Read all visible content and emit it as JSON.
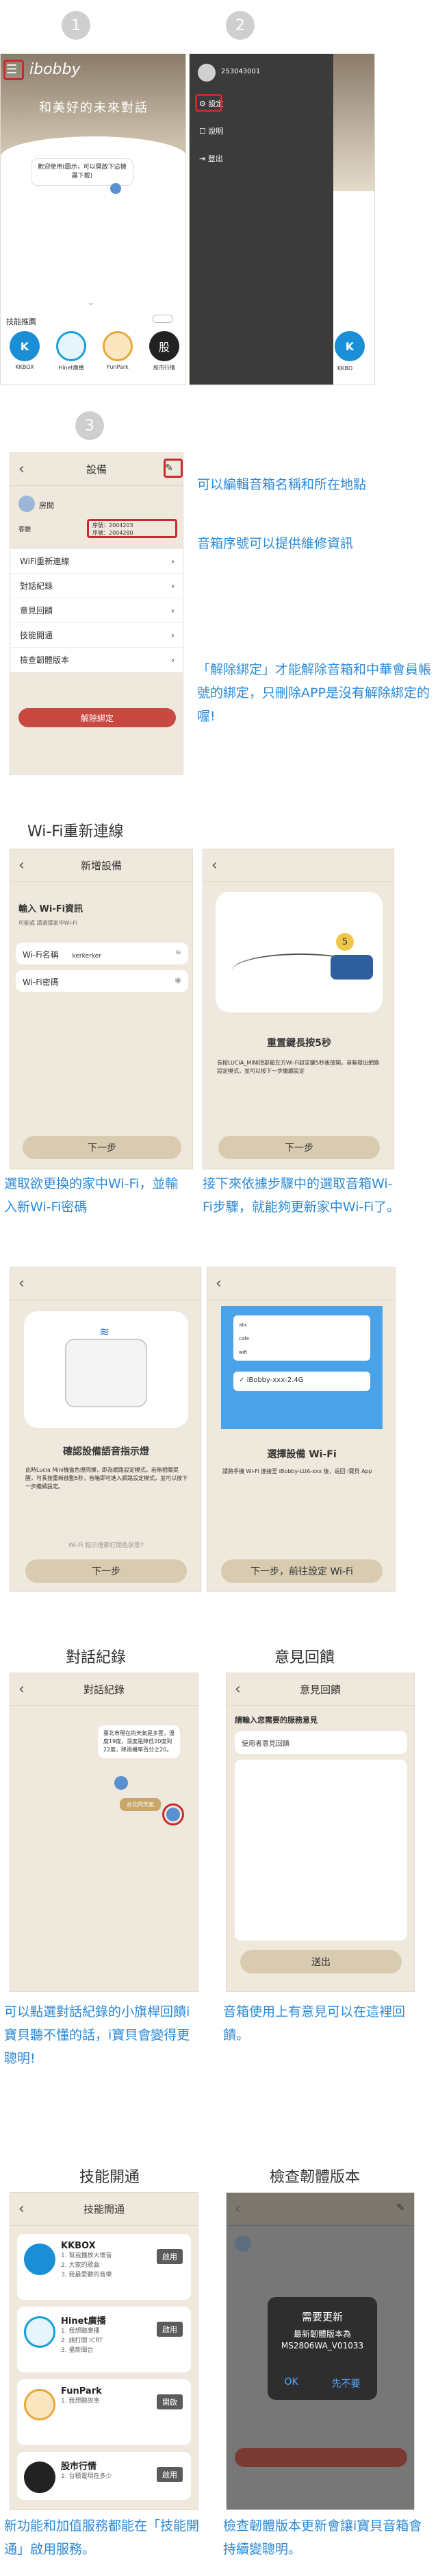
{
  "step_numbers": [
    "1",
    "2",
    "3"
  ],
  "home": {
    "logo": "ibobby",
    "slogan": "和美好的未來對話",
    "bubble": "歡迎使用(圖示，可以開啟下這機器下載)",
    "skills_title": "技能推薦",
    "skills": [
      {
        "label": "KKBOX",
        "color": "#1b8fd6",
        "icon": "kkbox-icon"
      },
      {
        "label": "Hinet廣播",
        "color": "#1aa0d8",
        "icon": "hinet-icon"
      },
      {
        "label": "FunPark",
        "color": "#e8a83a",
        "icon": "funpark-icon"
      },
      {
        "label": "股市行情",
        "color": "#222222",
        "icon": "stock-icon"
      }
    ]
  },
  "menu": {
    "phone": "253043001",
    "items": [
      "設定",
      "說明",
      "登出"
    ],
    "side_label": "KKBO"
  },
  "settings": {
    "title": "設備",
    "device_name": "房間",
    "serial_label": "序號：2004203",
    "serial_2": "序號：2004280",
    "location": "客廳",
    "menu": [
      "WiFi重新連線",
      "對話紀錄",
      "意見回饋",
      "技能開通",
      "檢查韌體版本"
    ],
    "unbind": "解除綁定",
    "note1": "可以編輯音箱名稱和所在地點",
    "note2": "音箱序號可以提供維修資訊",
    "note3": "「解除綁定」才能解除音箱和中華會員帳號的綁定，只刪除APP是沒有解除綁定的喔!"
  },
  "wifi": {
    "section": "Wi-Fi重新連線",
    "s1_title": "新增設備",
    "s1_head": "輸入 Wi-Fi資訊",
    "s1_sub": "可能或 請選擇家中Wi-Fi",
    "s1_name_label": "Wi-Fi名稱",
    "s1_name_val": "kerkerker",
    "s1_pw_label": "Wi-Fi密碼",
    "next": "下一步",
    "s2_title": "重置鍵長按5秒",
    "s2_timer": "5",
    "s2_desc": "長按LUCIA_MINI頂部最左方Wi-Fi設定鍵5秒後放開，音箱發出網路設定模式，並可以按下一步繼續設定",
    "s3_title": "確認設備語音指示燈",
    "s3_desc": "此時Lucia Mini機盒色燈閃爍，即為網路設定模式，若無相關提醒，可長按重新啟動5秒，音箱即可進入網路設定模式，並可以按下一步繼續設定。",
    "s3_link": "Wi-Fi 指示燈都打開色狀態?",
    "s4_title": "選擇設備 Wi-Fi",
    "s4_desc": "請將手機 Wi-Fi 連接至 iBobby-LUA-xxx 後，返回 i寶貝 App",
    "s4_wifi": [
      "abc",
      "cafe",
      "wifi"
    ],
    "s4_sel": "iBobby-xxx-2.4G",
    "s4_next": "下一步，前往設定 Wi-Fi",
    "cap1": "選取欲更換的家中Wi-Fi，並輸入新Wi-Fi密碼",
    "cap2": "接下來依據步驟中的選取音箱Wi-Fi步驟，就能夠更新家中Wi-Fi了。"
  },
  "dialog": {
    "section": "對話紀錄",
    "title": "對話紀錄",
    "msg1": "臺北市現在的天氣是多雲，溫度19度，濕度是降低20度到22度，降雨機率百分之20。",
    "msg2": "台北的天氣",
    "cap": "可以點選對話紀錄的小旗桿回饋i寶貝聽不懂的話，i寶貝會變得更聰明!"
  },
  "feedback": {
    "section": "意見回饋",
    "title": "意見回饋",
    "prompt": "請輸入您需要的服務意見",
    "placeholder": "使用者意見回饋",
    "send": "送出",
    "cap": "音箱使用上有意見可以在這裡回饋。"
  },
  "skillopen": {
    "section": "技能開通",
    "title": "技能開通",
    "items": [
      {
        "name": "KKBOX",
        "lines": [
          "1. 幫我播放大壞音",
          "2. 大家的歌曲",
          "3. 我最愛聽的音樂"
        ],
        "status": "啟用"
      },
      {
        "name": "Hinet廣播",
        "lines": [
          "1. 我想聽廣播",
          "2. 請打開 ICRT",
          "3. 播新聞台"
        ],
        "status": "啟用"
      },
      {
        "name": "FunPark",
        "lines": [
          "1. 我想聽故事"
        ],
        "status": "開啟"
      },
      {
        "name": "股市行情",
        "lines": [
          "1. 台積電現在多少"
        ],
        "status": "啟用"
      }
    ],
    "cap": "新功能和加值服務都能在「技能開通」啟用服務。"
  },
  "firmware": {
    "section": "檢查韌體版本",
    "popup_title": "需要更新",
    "popup_line": "最新韌體版本為",
    "version": "MS2806WA_V01033",
    "ok": "OK",
    "later": "先不要",
    "cap": "檢查韌體版本更新會讓i寶貝音箱會持續變聰明。"
  }
}
